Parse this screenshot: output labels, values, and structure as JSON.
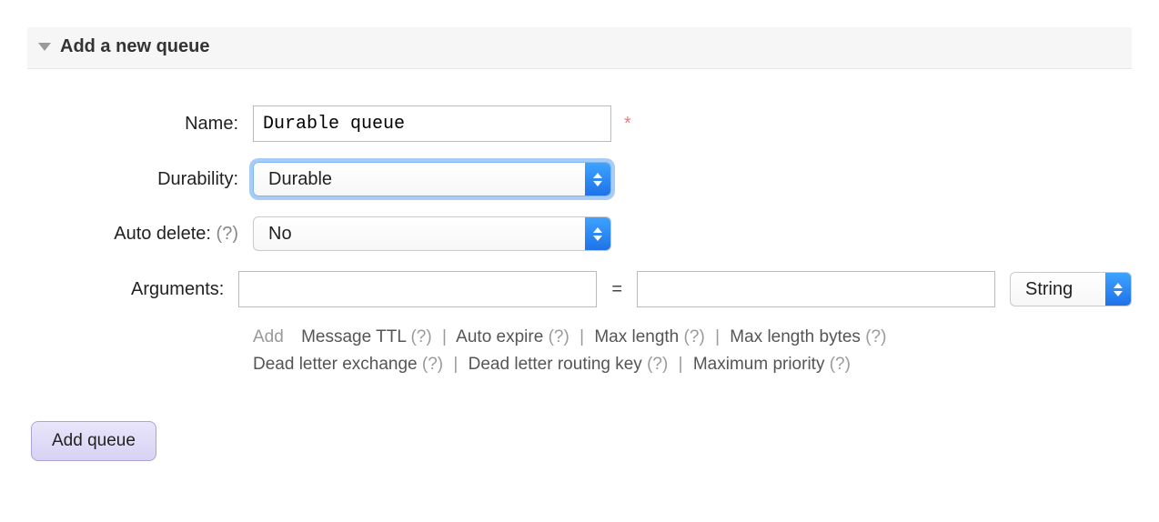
{
  "section": {
    "title": "Add a new queue"
  },
  "labels": {
    "name": "Name:",
    "durability": "Durability:",
    "auto_delete": "Auto delete:",
    "auto_delete_help": "(?)",
    "arguments": "Arguments:"
  },
  "form": {
    "name_value": "Durable queue",
    "required_mark": "*",
    "durability_selected": "Durable",
    "auto_delete_selected": "No",
    "arg_key": "",
    "arg_equals": "=",
    "arg_value": "",
    "arg_type_selected": "String"
  },
  "shortcuts": {
    "add_label": "Add",
    "items_line1": [
      {
        "label": "Message TTL",
        "help": "(?)"
      },
      {
        "label": "Auto expire",
        "help": "(?)"
      },
      {
        "label": "Max length",
        "help": "(?)"
      },
      {
        "label": "Max length bytes",
        "help": "(?)"
      }
    ],
    "items_line2": [
      {
        "label": "Dead letter exchange",
        "help": "(?)"
      },
      {
        "label": "Dead letter routing key",
        "help": "(?)"
      },
      {
        "label": "Maximum priority",
        "help": "(?)"
      }
    ],
    "separator": "|"
  },
  "buttons": {
    "add_queue": "Add queue"
  }
}
